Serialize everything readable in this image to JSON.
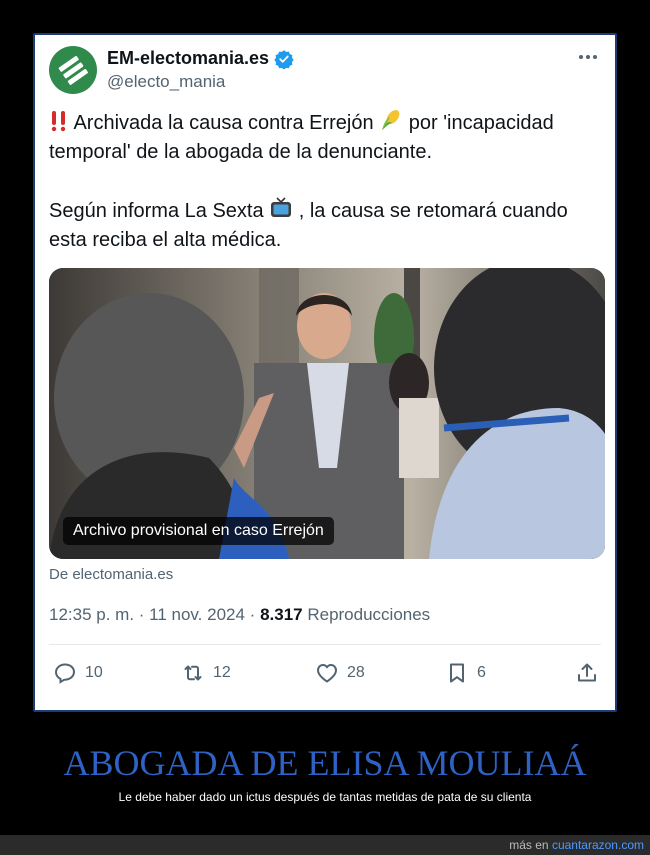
{
  "tweet": {
    "display_name": "EM-electomania.es",
    "handle": "@electo_mania",
    "paragraph1_line1_a": "Archivada la causa contra Errejón",
    "paragraph1_line1_b": "por 'incapacidad",
    "paragraph1_line2": "temporal' de la abogada de la denunciante.",
    "paragraph2_line1_a": "Según informa  La Sexta",
    "paragraph2_line1_b": ", la causa se retomará cuando",
    "paragraph2_line2": "esta reciba el alta médica.",
    "media_caption": "Archivo provisional en caso Errejón",
    "source": "De electomania.es",
    "timestamp": "12:35 p. m. · 11 nov. 2024 · ",
    "views_count": "8.317",
    "views_label": " Reproducciones",
    "stats": {
      "replies": "10",
      "retweets": "12",
      "likes": "28",
      "bookmarks": "6"
    }
  },
  "meme": {
    "headline": "ABOGADA DE ELISA MOULIAÁ",
    "subline": "Le debe haber dado un ictus después de tantas metidas de pata de su clienta"
  },
  "footer": {
    "prefix": "más en ",
    "site": "cuantarazon.com"
  },
  "icons": {
    "avatar": "electomania-logo",
    "verified": "verified-badge-icon",
    "more": "more-icon",
    "reply": "reply-icon",
    "retweet": "retweet-icon",
    "like": "heart-icon",
    "bookmark": "bookmark-icon",
    "share": "share-icon"
  },
  "colors": {
    "verified_blue": "#1d9bf0",
    "headline_blue": "#2e62c4",
    "link_blue": "#4b9bff",
    "avatar_green": "#2f8a4c"
  }
}
